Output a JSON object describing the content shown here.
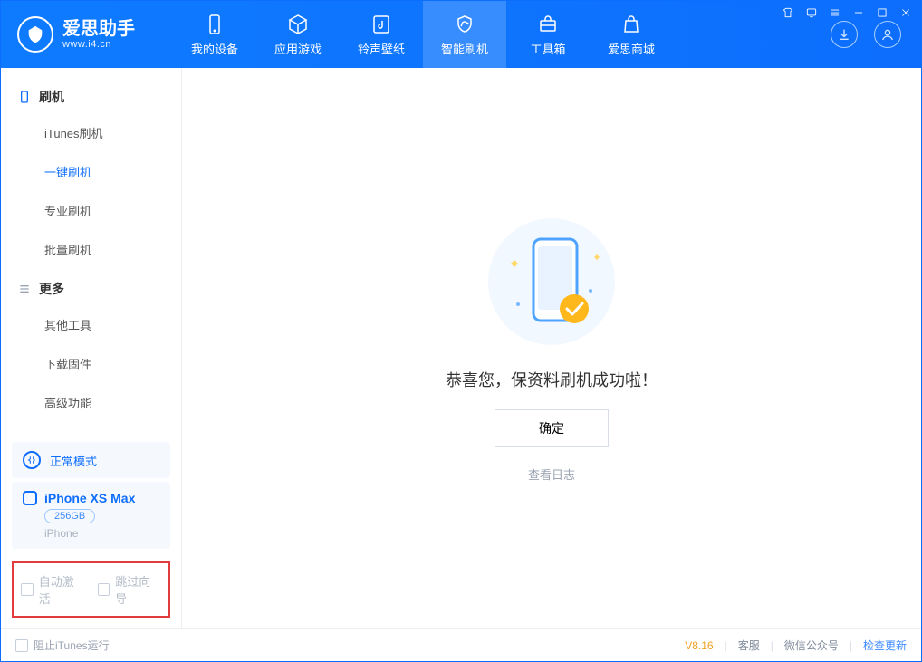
{
  "app": {
    "name_cn": "爱思助手",
    "name_en": "www.i4.cn"
  },
  "nav": {
    "my_device": "我的设备",
    "apps_games": "应用游戏",
    "ring_wall": "铃声壁纸",
    "smart_flash": "智能刷机",
    "toolbox": "工具箱",
    "store": "爱思商城"
  },
  "sidebar": {
    "group_flash": "刷机",
    "items_flash": {
      "itunes": "iTunes刷机",
      "onekey": "一键刷机",
      "pro": "专业刷机",
      "batch": "批量刷机"
    },
    "group_more": "更多",
    "items_more": {
      "other_tools": "其他工具",
      "download_fw": "下载固件",
      "advanced": "高级功能"
    }
  },
  "mode": {
    "label": "正常模式"
  },
  "device": {
    "name": "iPhone XS Max",
    "storage": "256GB",
    "type": "iPhone"
  },
  "options": {
    "auto_activate": "自动激活",
    "skip_guide": "跳过向导"
  },
  "main": {
    "success": "恭喜您，保资料刷机成功啦！",
    "ok": "确定",
    "view_log": "查看日志"
  },
  "footer": {
    "block_itunes": "阻止iTunes运行",
    "version": "V8.16",
    "support": "客服",
    "wechat": "微信公众号",
    "check_update": "检查更新"
  }
}
